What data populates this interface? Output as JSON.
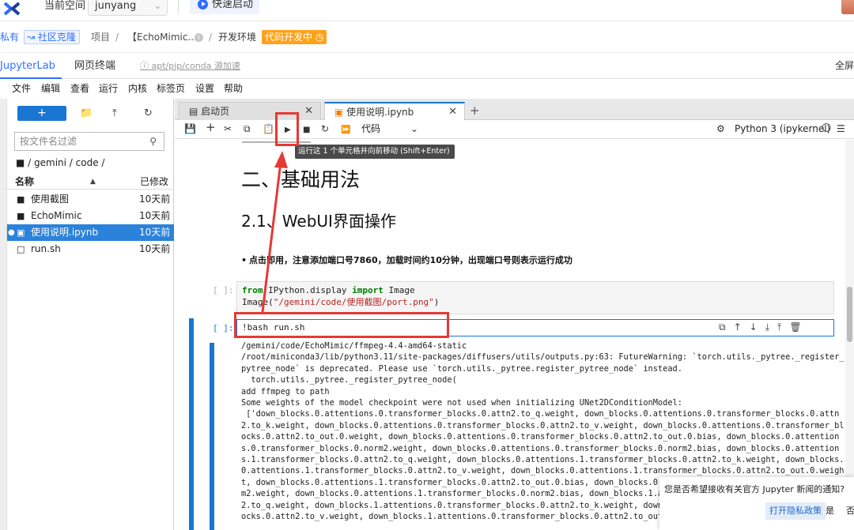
{
  "topbar": {
    "space_label": "当前空间",
    "space_value": "junyang",
    "quick_start": "快速启动"
  },
  "breadcrumb": {
    "private": "私有",
    "community": "社区克隆",
    "project": "项目",
    "sep": "/",
    "name": "【EchoMimic...",
    "env": "开发环境",
    "status": "代码开发中"
  },
  "modes": {
    "jupyterlab": "JupyterLab",
    "terminal": "网页终端",
    "mirror": "apt/pip/conda 源加速",
    "fullscreen": "全屏"
  },
  "menu": [
    "文件",
    "编辑",
    "查看",
    "运行",
    "内核",
    "标签页",
    "设置",
    "帮助"
  ],
  "filebrowser": {
    "filter_placeholder": "按文件名过滤",
    "path": "/ gemini / code /",
    "col_name": "名称",
    "col_modified": "已修改",
    "files": [
      {
        "name": "使用截图",
        "modified": "10天前",
        "icon": "folder-icon"
      },
      {
        "name": "EchoMimic",
        "modified": "10天前",
        "icon": "folder-icon"
      },
      {
        "name": "使用说明.ipynb",
        "modified": "10天前",
        "icon": "notebook-icon",
        "selected": true
      },
      {
        "name": "run.sh",
        "modified": "10天前",
        "icon": "file-icon"
      }
    ]
  },
  "tabs": {
    "launcher": "启动页",
    "notebook": "使用说明.ipynb"
  },
  "nbtoolbar": {
    "cell_type": "代码",
    "kernel": "Python 3 (ipykernel)",
    "tooltip": "运行这 1 个单元格并向前移动 (Shift+Enter)"
  },
  "notebook": {
    "h2": "二、基础用法",
    "h3": "2.1、WebUI界面操作",
    "bullet": "点击即用，注意添加端口号7860，加载时间约10分钟，出现端口号则表示运行成功",
    "prompt": "[ ]:",
    "code1_from": "from",
    "code1_mod": " IPython.display ",
    "code1_import": "import",
    "code1_rest": " Image",
    "code1_line2a": "Image(",
    "code1_line2b": "\"/gemini/code/使用截图/port.png\"",
    "code1_line2c": ")",
    "code2": "!bash run.sh",
    "output": "/gemini/code/EchoMimic/ffmpeg-4.4-amd64-static\n/root/miniconda3/lib/python3.11/site-packages/diffusers/utils/outputs.py:63: FutureWarning: `torch.utils._pytree._register_\npytree_node` is deprecated. Please use `torch.utils._pytree.register_pytree_node` instead.\n  torch.utils._pytree._register_pytree_node(\nadd ffmpeg to path\nSome weights of the model checkpoint were not used when initializing UNet2DConditionModel:\n ['down_blocks.0.attentions.0.transformer_blocks.0.attn2.to_q.weight, down_blocks.0.attentions.0.transformer_blocks.0.attn\n2.to_k.weight, down_blocks.0.attentions.0.transformer_blocks.0.attn2.to_v.weight, down_blocks.0.attentions.0.transformer_bl\nocks.0.attn2.to_out.0.weight, down_blocks.0.attentions.0.transformer_blocks.0.attn2.to_out.0.bias, down_blocks.0.attention\ns.0.transformer_blocks.0.norm2.weight, down_blocks.0.attentions.0.transformer_blocks.0.norm2.bias, down_blocks.0.attention\ns.1.transformer_blocks.0.attn2.to_q.weight, down_blocks.0.attentions.1.transformer_blocks.0.attn2.to_k.weight, down_blocks.\n0.attentions.1.transformer_blocks.0.attn2.to_v.weight, down_blocks.0.attentions.1.transformer_blocks.0.attn2.to_out.0.weigh\nt, down_blocks.0.attentions.1.transformer_blocks.0.attn2.to_out.0.bias, down_blocks.0.at\nm2.weight, down_blocks.0.attentions.1.transformer_blocks.0.norm2.bias, down_blocks.1.at\n2.to_q.weight, down_blocks.1.attentions.0.transformer_blocks.0.attn2.to_k.weight, down_\nocks.0.attn2.to_v.weight, down_blocks.1.attentions.0.transformer_blocks.0.attn2.to_out."
  },
  "notify": {
    "text": "您是否希望接收有关官方 Jupyter 新闻的通知?",
    "privacy": "打开隐私政策",
    "yes": "是",
    "no": "否"
  },
  "colors": {
    "accent": "#1976d2",
    "brand": "#3370ff",
    "annotation": "#e53935",
    "status_badge": "#ffa21a"
  }
}
